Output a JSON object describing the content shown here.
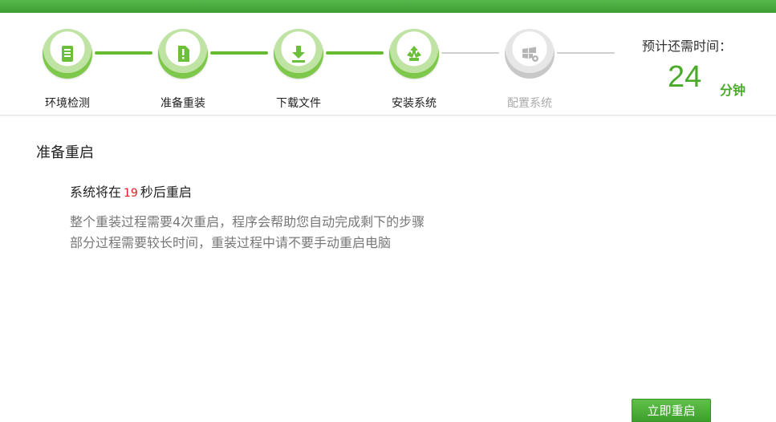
{
  "header": {
    "steps": [
      {
        "label": "环境检测",
        "status": "done",
        "icon": "checklist-document-icon"
      },
      {
        "label": "准备重装",
        "status": "done",
        "icon": "alert-document-icon"
      },
      {
        "label": "下载文件",
        "status": "done",
        "icon": "download-icon"
      },
      {
        "label": "安装系统",
        "status": "done",
        "icon": "recycle-install-icon"
      },
      {
        "label": "配置系统",
        "status": "pending",
        "icon": "windows-gear-icon"
      }
    ],
    "eta_label": "预计还需时间：",
    "eta_value": "24",
    "eta_unit": "分钟"
  },
  "main": {
    "section_title": "准备重启",
    "countdown_prefix": "系统将在",
    "countdown_seconds": "19",
    "countdown_suffix": "秒后重启",
    "desc_line1": "整个重装过程需要4次重启，程序会帮助您自动完成剩下的步骤",
    "desc_line2": "部分过程需要较长时间，重装过程中请不要手动重启电脑"
  },
  "footer": {
    "restart_now_label": "立即重启"
  },
  "colors": {
    "accent_green": "#4aab2a",
    "countdown_red": "#e02020",
    "pending_gray": "#c8c8c8"
  }
}
